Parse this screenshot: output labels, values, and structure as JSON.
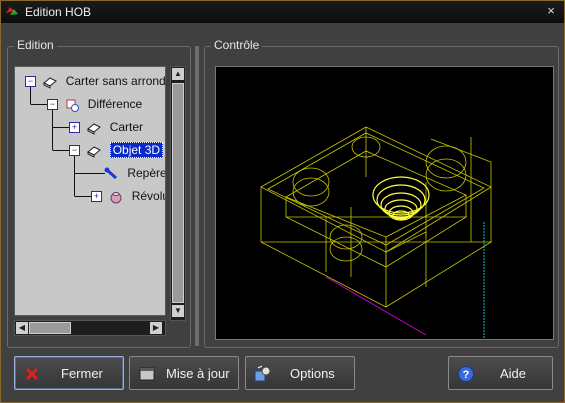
{
  "window": {
    "title": "Edition HOB",
    "close_glyph": "×"
  },
  "edition": {
    "label": "Edition",
    "tree": [
      {
        "label": "Carter sans arrondis",
        "icon": "part-icon",
        "expander": "−",
        "selected": false
      },
      {
        "label": "Différence",
        "icon": "boolean-difference-icon",
        "expander": "−",
        "selected": false
      },
      {
        "label": "Carter",
        "icon": "part-icon",
        "expander": "+",
        "selected": false
      },
      {
        "label": "Objet 3D",
        "icon": "part-icon",
        "expander": "−",
        "selected": true
      },
      {
        "label": "Repère",
        "icon": "wrench-icon",
        "expander": "",
        "selected": false
      },
      {
        "label": "Révolution",
        "icon": "revolution-icon",
        "expander": "+",
        "selected": false
      }
    ]
  },
  "controle": {
    "label": "Contrôle"
  },
  "buttons": {
    "close": {
      "label": "Fermer",
      "icon": "red-x-icon"
    },
    "update": {
      "label": "Mise à jour",
      "icon": "window-icon"
    },
    "options": {
      "label": "Options",
      "icon": "options-icon"
    },
    "help": {
      "label": "Aide",
      "icon": "help-icon"
    }
  },
  "colors": {
    "accent_border": "#8a6a2a",
    "selection": "#0a2ac8",
    "wireframe": "#d4d400",
    "highlight": "#ffff40",
    "axis_cyan": "#00c8c8",
    "axis_magenta": "#c800c8"
  }
}
